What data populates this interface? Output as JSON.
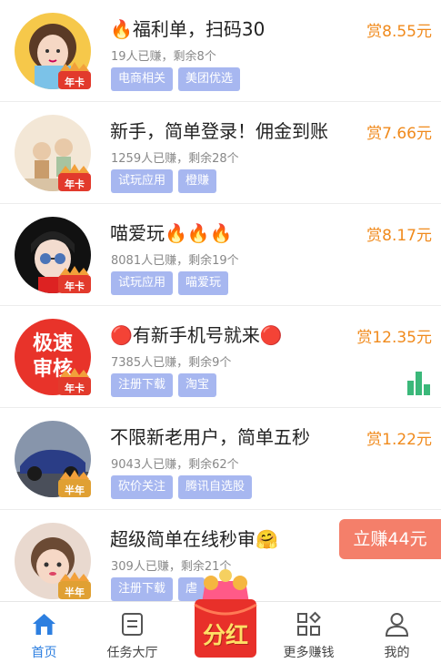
{
  "tasks": [
    {
      "title": "🔥福利单，扫码30",
      "stats": "19人已赚，剩余8个",
      "tags": [
        "电商相关",
        "美团优选"
      ],
      "reward": "赏8.55元",
      "badge": "年卡",
      "avatar_icon": "girl-photo"
    },
    {
      "title": "新手，简单登录！佣金到账",
      "stats": "1259人已赚，剩余28个",
      "tags": [
        "试玩应用",
        "橙赚"
      ],
      "reward": "赏7.66元",
      "badge": "年卡",
      "avatar_icon": "cartoon-scene"
    },
    {
      "title": "喵爱玩🔥🔥🔥",
      "stats": "8081人已赚，剩余19个",
      "tags": [
        "试玩应用",
        "喵爱玩"
      ],
      "reward": "赏8.17元",
      "badge": "年卡",
      "avatar_icon": "anime-girl-sunglasses"
    },
    {
      "title": "🔴有新手机号就来🔴",
      "stats": "7385人已赚，剩余9个",
      "tags": [
        "注册下载",
        "淘宝"
      ],
      "reward": "赏12.35元",
      "badge": "年卡",
      "avatar_icon": "red-text-logo",
      "avatar_text": [
        "极速",
        "审核"
      ],
      "show_stats_icon": true
    },
    {
      "title": "不限新老用户，简单五秒",
      "stats": "9043人已赚，剩余62个",
      "tags": [
        "砍价关注",
        "腾讯自选股"
      ],
      "reward": "赏1.22元",
      "badge": "半年",
      "avatar_icon": "car-photo"
    },
    {
      "title": "超级简单在线秒审🤗",
      "stats": "309人已赚，剩余21个",
      "tags": [
        "注册下载",
        "虐"
      ],
      "reward": "立赚44元",
      "badge": "半年",
      "avatar_icon": "baby-photo"
    }
  ],
  "bottom_nav": {
    "items": [
      {
        "label": "首页",
        "icon": "home-icon",
        "active": true
      },
      {
        "label": "任务大厅",
        "icon": "task-list-icon",
        "active": false
      },
      {
        "label": "分红",
        "icon": "red-envelope-icon",
        "active": false
      },
      {
        "label": "更多赚钱",
        "icon": "grid-apps-icon",
        "active": false
      },
      {
        "label": "我的",
        "icon": "user-icon",
        "active": false
      }
    ]
  },
  "colors": {
    "accent": "#2d7fe0",
    "reward": "#f08a1c",
    "tag_bg": "#a7b7f0",
    "earn_button": "#f47f6a",
    "stats_icon": "#3bb87a"
  }
}
